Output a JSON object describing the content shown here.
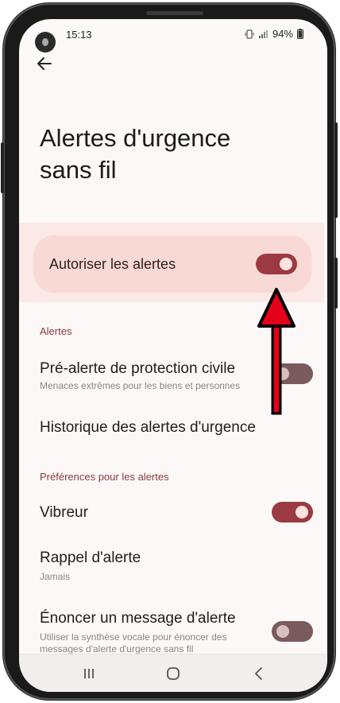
{
  "status_bar": {
    "time": "15:13",
    "battery": "94%",
    "icons": [
      "camera-dot",
      "vibrate-icon",
      "signal-icon",
      "battery-icon"
    ]
  },
  "header": {
    "title": "Alertes d'urgence sans fil"
  },
  "main_switch": {
    "label": "Autoriser les alertes",
    "state": "on"
  },
  "sections": {
    "alerts": {
      "header": "Alertes",
      "civil_protection": {
        "title": "Pré-alerte de protection civile",
        "subtitle": "Menaces extrêmes pour les biens et personnes",
        "state": "off"
      },
      "history": {
        "title": "Historique des alertes d'urgence"
      }
    },
    "preferences": {
      "header": "Préférences pour les alertes",
      "vibrate": {
        "title": "Vibreur",
        "state": "on"
      },
      "reminder": {
        "title": "Rappel d'alerte",
        "subtitle": "Jamais"
      },
      "speak": {
        "title": "Énoncer un message d'alerte",
        "subtitle": "Utiliser la synthèse vocale pour énoncer des messages d'alerte d'urgence sans fil",
        "state": "off"
      }
    }
  },
  "colors": {
    "accent": "#9b3a40",
    "highlight_card": "#f9d9d5",
    "section_header": "#8a3a3a",
    "annotation_arrow": "#e5001a"
  }
}
